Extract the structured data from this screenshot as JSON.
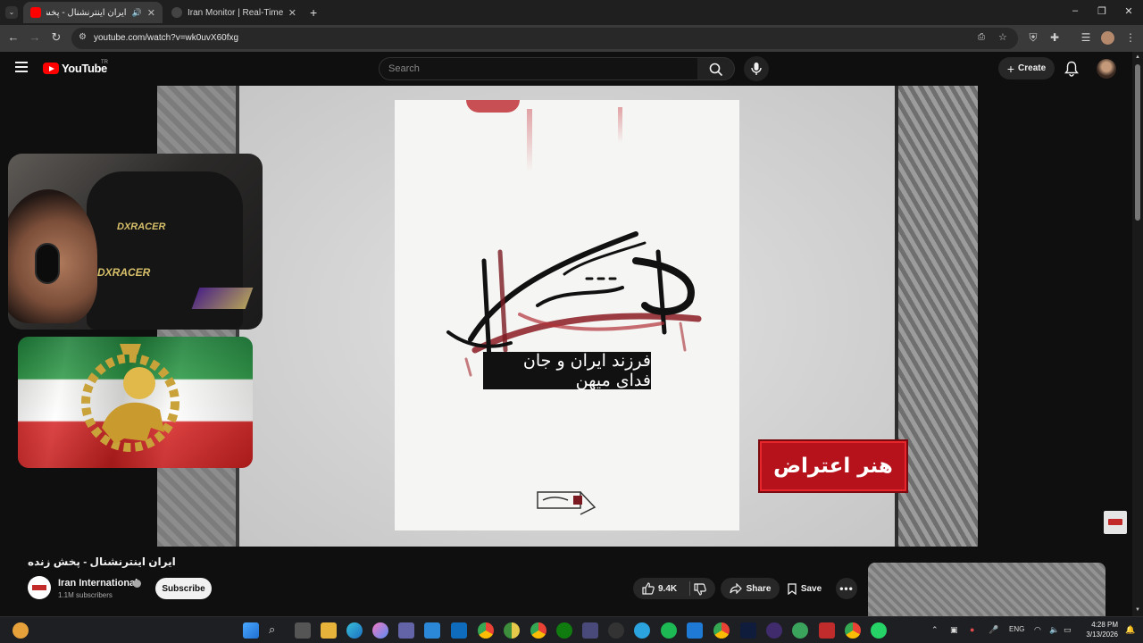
{
  "browser": {
    "tabs": [
      {
        "title": "ایران اینترنشنال - پخش زنده",
        "active": true,
        "favicon": "youtube-icon"
      },
      {
        "title": "Iran Monitor | Real-Time OSINT",
        "active": false,
        "favicon": "osint-icon"
      }
    ],
    "new_tab": "+",
    "url": "youtube.com/watch?v=wk0uvX60fxg"
  },
  "youtube": {
    "logo_text": "YouTube",
    "region": "TR",
    "search_placeholder": "Search",
    "create_label": "Create"
  },
  "video": {
    "poster_caption": "فرزند ایران و جان فدای میهن",
    "badge_text": "هنر اعتراض",
    "title": "ایران اینترنشنال - پخش زنده",
    "channel_name": "Iran International",
    "subscribers": "1.1M subscribers",
    "subscribe_label": "Subscribe",
    "likes": "9.4K",
    "share_label": "Share",
    "save_label": "Save"
  },
  "taskbar": {
    "lang": "ENG",
    "time": "4:28 PM",
    "date": "3/13/2026"
  },
  "colors": {
    "youtube_red": "#ff0000",
    "badge_red": "#b5121b",
    "background": "#0f0f0f"
  }
}
